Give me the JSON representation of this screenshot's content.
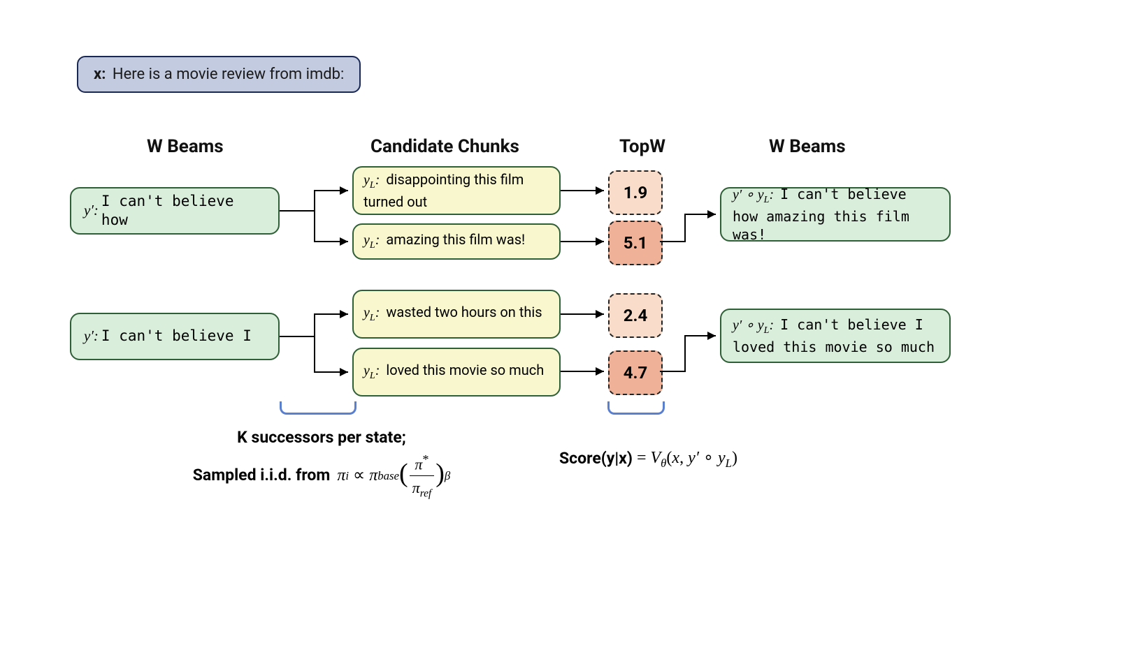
{
  "prompt": {
    "prefix": "x:",
    "text": "Here is a movie review from imdb:"
  },
  "column_titles": {
    "beams_left": "W Beams",
    "candidates": "Candidate Chunks",
    "topw": "TopW",
    "beams_right": "W Beams"
  },
  "beams": [
    {
      "var": "y′",
      "text": "I can't believe how"
    },
    {
      "var": "y′",
      "text": "I can't believe I"
    }
  ],
  "candidates": [
    {
      "var": "yL",
      "text": "disappointing this film turned out"
    },
    {
      "var": "yL",
      "text": "amazing this film was!"
    },
    {
      "var": "yL",
      "text": "wasted two hours on this"
    },
    {
      "var": "yL",
      "text": "loved this movie so much"
    }
  ],
  "scores": [
    "1.9",
    "5.1",
    "2.4",
    "4.7"
  ],
  "outputs": [
    {
      "var": "y′ ∘ yL",
      "text": "I can't believe how amazing this film was!"
    },
    {
      "var": "y′ ∘ yL",
      "text": "I can't believe I loved this movie so much"
    }
  ],
  "captions": {
    "successors_l1": "K successors per state;",
    "successors_l2": "Sampled i.i.d. from",
    "score_label": "Score(y|x)"
  }
}
